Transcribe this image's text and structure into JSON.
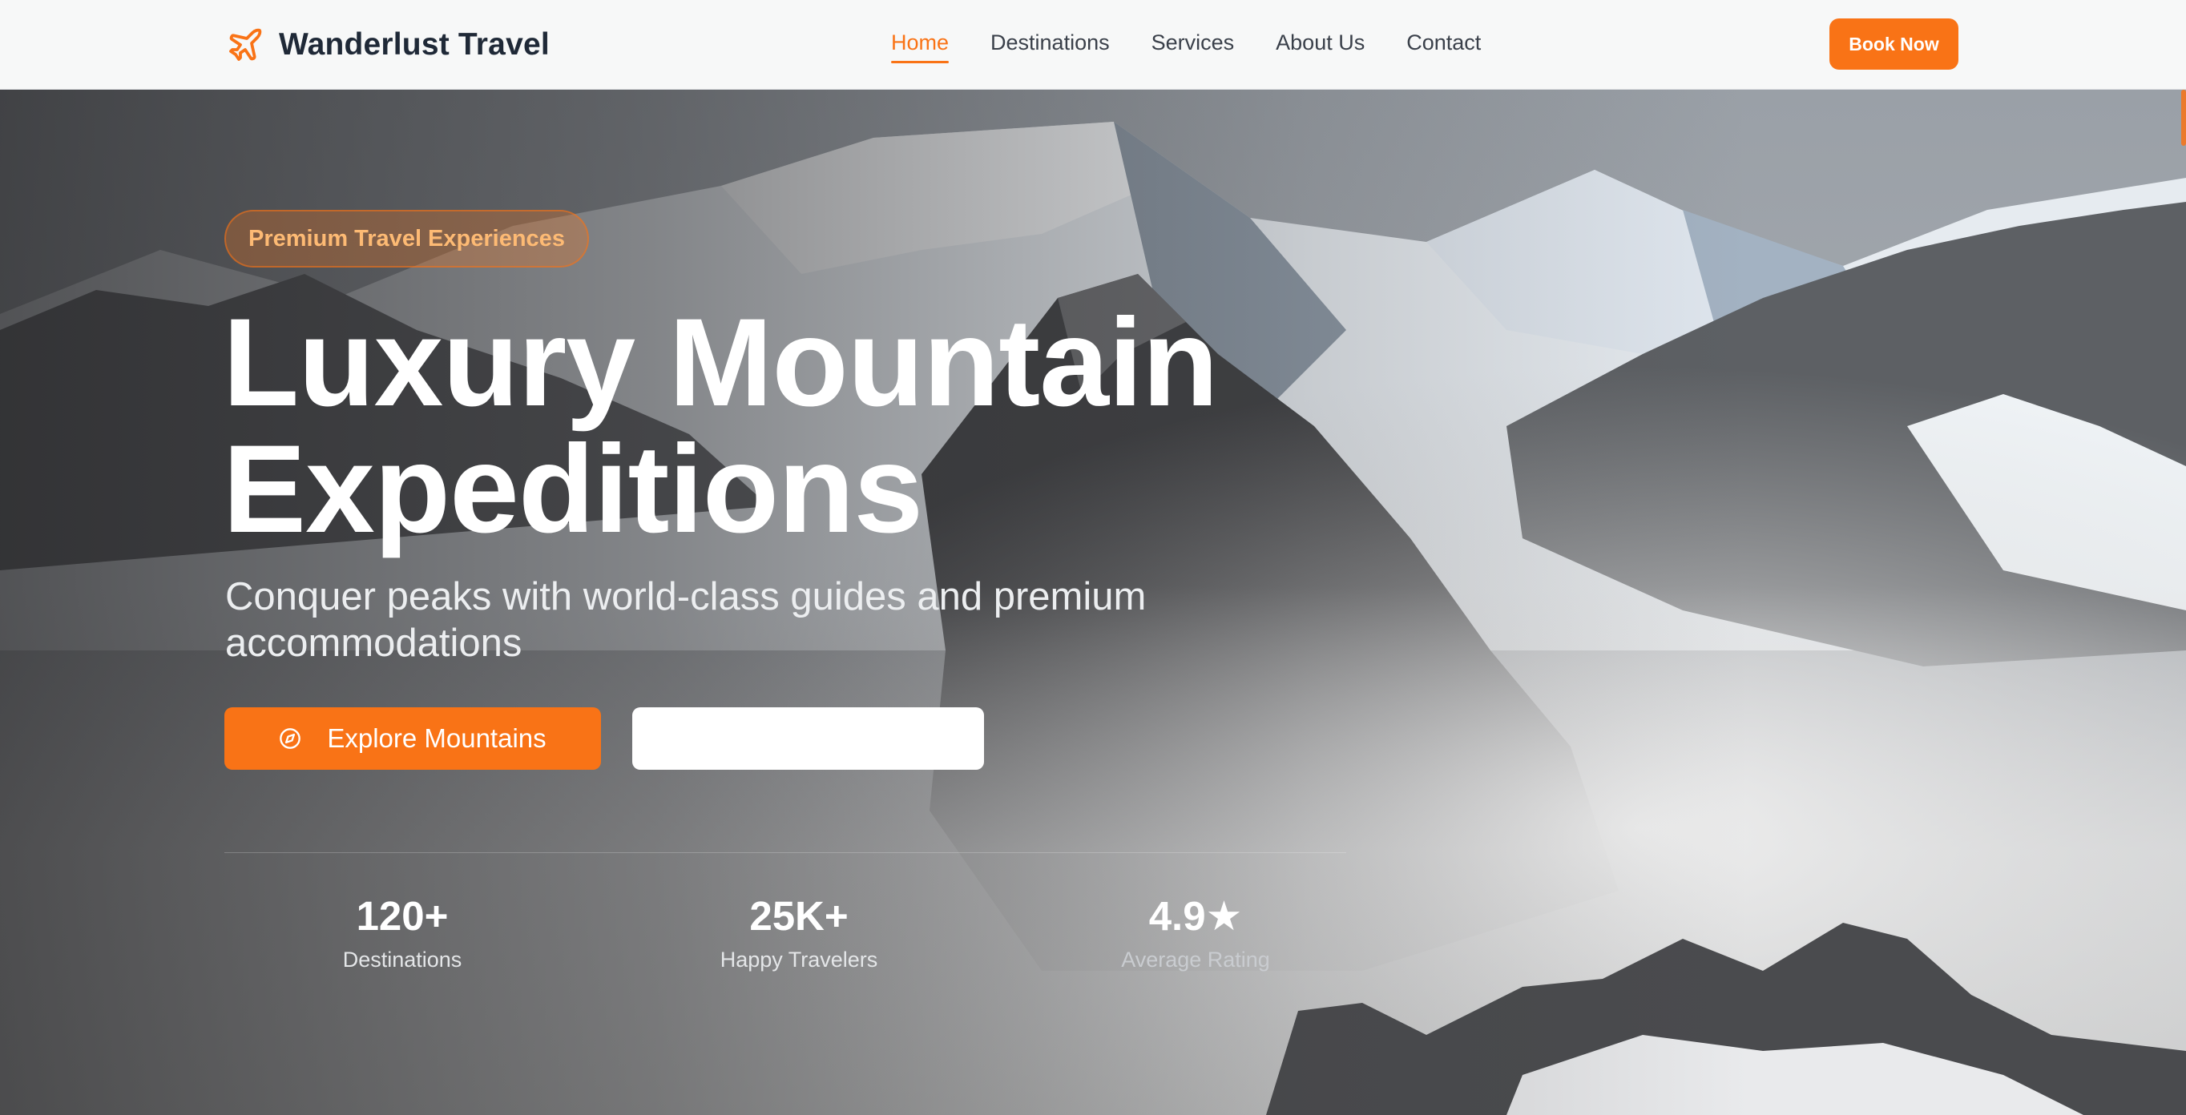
{
  "brand": {
    "name": "Wanderlust Travel",
    "icon": "airplane-icon",
    "accent_color": "#f97316"
  },
  "nav": {
    "items": [
      {
        "label": "Home",
        "active": true
      },
      {
        "label": "Destinations",
        "active": false
      },
      {
        "label": "Services",
        "active": false
      },
      {
        "label": "About Us",
        "active": false
      },
      {
        "label": "Contact",
        "active": false
      }
    ],
    "book_label": "Book Now"
  },
  "hero": {
    "badge": "Premium Travel Experiences",
    "title_line1": "Luxury Mountain",
    "title_line2": "Expeditions",
    "subtitle": "Conquer peaks with world-class guides and premium accommodations",
    "primary_cta": {
      "label": "Explore Mountains",
      "icon": "compass-icon"
    },
    "secondary_cta": {
      "label": ""
    },
    "background": "snowy-mountain-peaks-above-clouds"
  },
  "stats": [
    {
      "value": "120+",
      "label": "Destinations"
    },
    {
      "value": "25K+",
      "label": "Happy Travelers"
    },
    {
      "value": "4.9★",
      "label": "Average Rating"
    }
  ],
  "colors": {
    "primary": "#f97316",
    "nav_background": "#f7f8f8",
    "text_dark": "#1f2937",
    "badge_text": "#fdba74"
  }
}
